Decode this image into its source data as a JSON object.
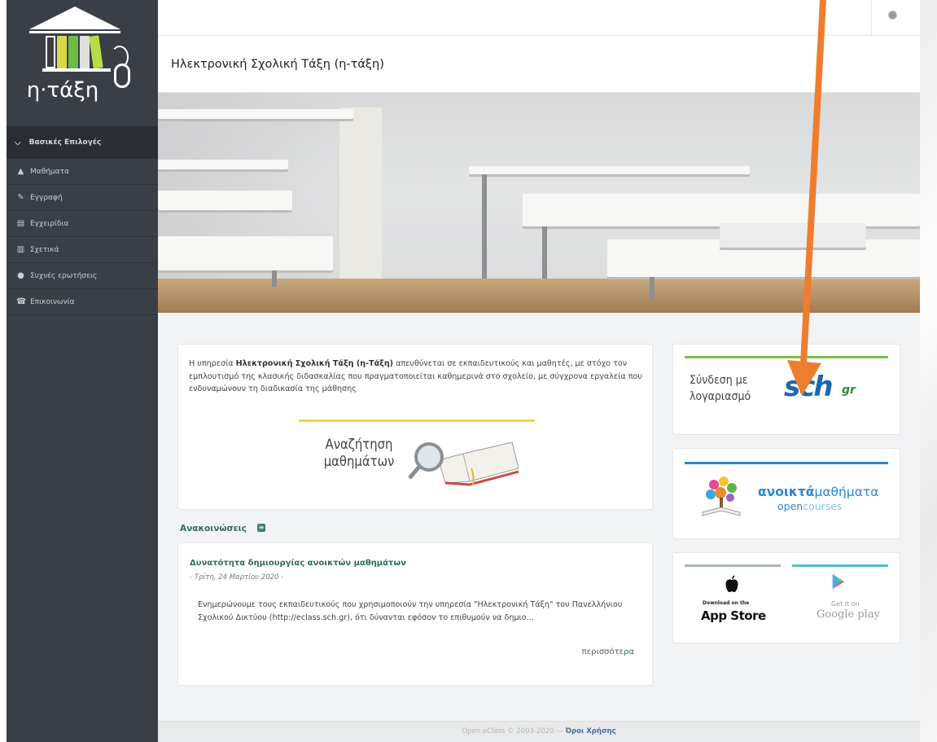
{
  "window": {
    "title": "Ηλεκτρονική Σχολική Τάξη (η-τάξη)"
  },
  "sidebar": {
    "logo_text": "η·τάξη",
    "section_label": "Βασικές Επιλογές",
    "items": [
      {
        "label": "Μαθήματα",
        "icon": "graduation-cap-icon"
      },
      {
        "label": "Εγγραφή",
        "icon": "edit-icon"
      },
      {
        "label": "Εγχειρίδια",
        "icon": "document-icon"
      },
      {
        "label": "Σχετικά",
        "icon": "panel-icon"
      },
      {
        "label": "Συχνές ερωτήσεις",
        "icon": "question-icon"
      },
      {
        "label": "Επικοινωνία",
        "icon": "phone-icon"
      }
    ]
  },
  "intro": {
    "text_before": "Η υπηρεσία ",
    "bold": "Ηλεκτρονική Σχολική Τάξη (η-Τάξη)",
    "text_after": " απευθύνεται σε εκπαιδευτικούς και μαθητές, με στόχο τον εμπλουτισμό της κλασικής διδασκαλίας που πραγματοποιείται καθημερινά στο σχολείο, με σύγχρονα εργαλεία που ενδυναμώνουν τη διαδικασία της μάθησης",
    "search_line1": "Αναζήτηση",
    "search_line2": "μαθημάτων"
  },
  "announcements": {
    "heading": "Ανακοινώσεις",
    "item": {
      "title": "Δυνατότητα δημιουργίας ανοικτών μαθημάτων",
      "date": "- Τρίτη, 24 Μαρτίου 2020 -",
      "body": "Ενημερώνουμε τους εκπαιδευτικούς που χρησιμοποιούν την υπηρεσία \"Ηλεκτρονική Τάξη\" του Πανελλήνιου Σχολικού Δικτύου (http://eclass.sch.gr), ότι δύνανται εφόσον το επιθυμούν να δημιο...",
      "more": "περισσότερα"
    }
  },
  "login": {
    "line1": "Σύνδεση με",
    "line2": "λογαριασμό",
    "brand": "sch",
    "brand_suffix": "gr"
  },
  "opencourses": {
    "title_bold": "ανοικτά",
    "title_rest": "μαθήματα",
    "sub_dark": "open",
    "sub_light": "courses"
  },
  "apps": {
    "apple_small": "Download on the",
    "apple_name": "App Store",
    "google_small": "Get it on",
    "google_name": "Google play"
  },
  "footer": {
    "text": "Open eClass © 2003-2020 — ",
    "link": "Όροι Χρήσης"
  },
  "colors": {
    "sidebar_bg": "#3a3f47",
    "accent_green": "#336b61",
    "arrow_orange": "#ef7d2e",
    "sch_blue": "#1b66b1",
    "opencourses_blue": "#2a86d6"
  }
}
